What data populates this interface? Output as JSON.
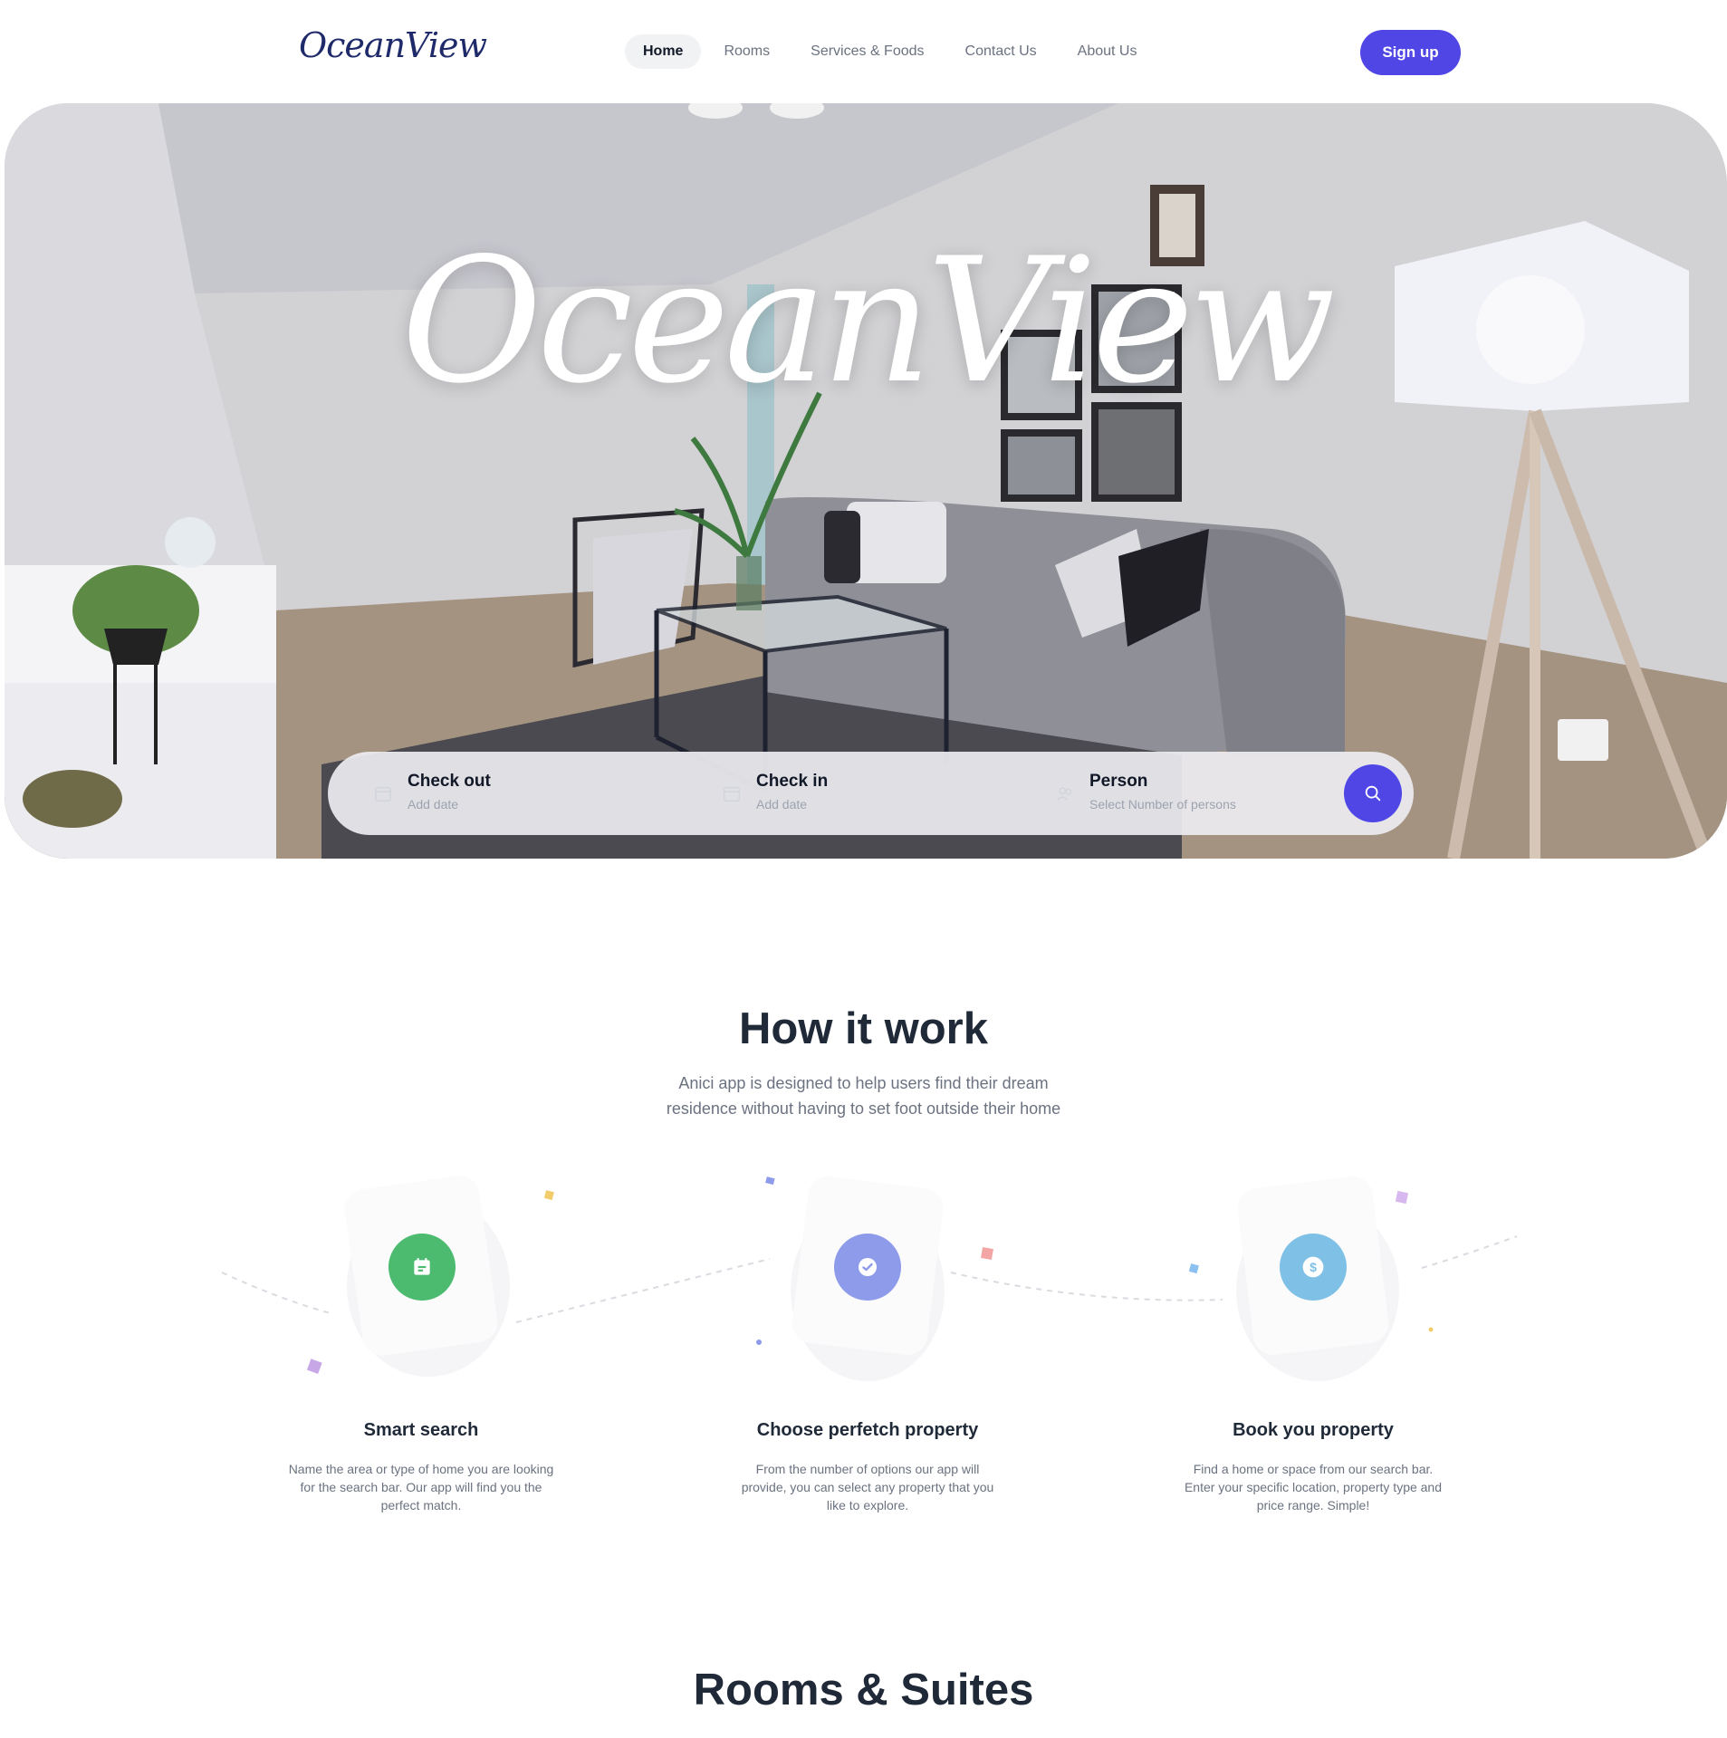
{
  "brand": {
    "logo_text": "OceanView",
    "accent": "#4f46e5"
  },
  "nav": {
    "links": [
      {
        "label": "Home",
        "active": true
      },
      {
        "label": "Rooms",
        "active": false
      },
      {
        "label": "Services & Foods",
        "active": false
      },
      {
        "label": "Contact Us",
        "active": false
      },
      {
        "label": "About Us",
        "active": false
      }
    ],
    "signup_label": "Sign up"
  },
  "hero": {
    "title": "OceanView",
    "search": {
      "fields": [
        {
          "label": "Check out",
          "sub": "Add date",
          "icon": "calendar-icon"
        },
        {
          "label": "Check in",
          "sub": "Add date",
          "icon": "calendar-icon"
        },
        {
          "label": "Person",
          "sub": "Select Number of persons",
          "icon": "people-icon"
        }
      ],
      "button_icon": "search-icon"
    }
  },
  "how": {
    "title": "How it work",
    "subtitle_line1": "Anici app is designed to help users find their dream",
    "subtitle_line2": "residence without having to set foot outside their home",
    "steps": [
      {
        "title": "Smart search",
        "desc": "Name the area or type of home you are looking for the search bar. Our app will find you the perfect match.",
        "icon": "calendar-icon",
        "color": "#4cbb6f"
      },
      {
        "title": "Choose perfetch property",
        "desc": "From the number of options our app will provide, you can select any property that you like to explore.",
        "icon": "check-icon",
        "color": "#8e9bea"
      },
      {
        "title": "Book you property",
        "desc": "Find a home or space from our search bar. Enter your specific location, property type and price range. Simple!",
        "icon": "dollar-icon",
        "color": "#7fc0e6"
      }
    ]
  },
  "rooms": {
    "title": "Rooms & Suites"
  }
}
